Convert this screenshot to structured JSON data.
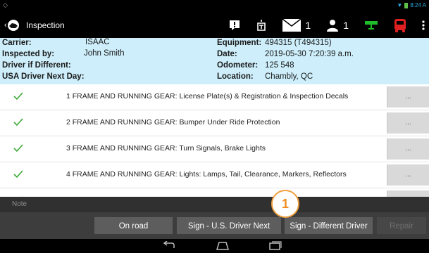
{
  "status": {
    "time": "8:24 A"
  },
  "appbar": {
    "title": "Inspection",
    "mail_count": "1",
    "driver_count": "1",
    "icons": [
      "alert-icon",
      "fuel-icon",
      "mail-icon",
      "person-icon",
      "trailer-icon",
      "truck-icon",
      "overflow-menu-icon"
    ],
    "colors": {
      "trailer": "#1fbd2a",
      "truck": "#e02020"
    }
  },
  "info": {
    "carrier_label": "Carrier:",
    "carrier_value": "ISAAC",
    "inspected_label": "Inspected by:",
    "inspected_value": "John Smith",
    "driver_diff_label": "Driver if Different:",
    "driver_diff_value": "",
    "usa_driver_label": "USA Driver Next Day:",
    "usa_driver_value": "",
    "equipment_label": "Equipment:",
    "equipment_value": "494315 (T494315)",
    "date_label": "Date:",
    "date_value": "2019-05-30 7:20:39 a.m.",
    "odometer_label": "Odometer:",
    "odometer_value": "125 548",
    "location_label": "Location:",
    "location_value": "Chambly, QC"
  },
  "items": [
    {
      "text": "1 FRAME AND RUNNING GEAR: License Plate(s) & Registration & Inspection Decals",
      "more": "..."
    },
    {
      "text": "2 FRAME AND RUNNING GEAR: Bumper Under Ride Protection",
      "more": "..."
    },
    {
      "text": "3 FRAME AND RUNNING GEAR: Turn Signals, Brake Lights",
      "more": "..."
    },
    {
      "text": "4 FRAME AND RUNNING GEAR: Lights: Lamps, Tail, Clearance, Markers, Reflectors",
      "more": "..."
    },
    {
      "text": "",
      "more": "..."
    }
  ],
  "note": {
    "label": "Note"
  },
  "buttons": {
    "breakdown": "On road breakdown",
    "sign_us": "Sign - U.S. Driver Next Day",
    "sign_diff": "Sign - Different Driver",
    "repair": "Repair"
  },
  "badge": {
    "number": "1"
  },
  "colors": {
    "info_bg": "#cdeefa",
    "check": "#3aa935",
    "badge": "#f08c20"
  }
}
